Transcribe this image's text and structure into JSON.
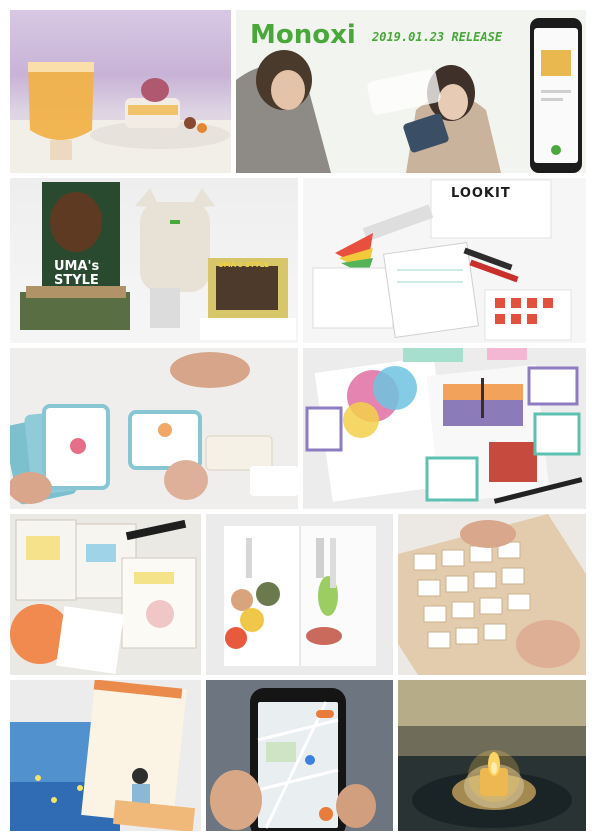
{
  "tiles": {
    "monoxi": {
      "brand": "Monoxi",
      "release": "2019.01.23 RELEASE"
    },
    "lookit": {
      "box_label": "LOOKIT"
    },
    "uma": {
      "poster_line1": "UMA's",
      "poster_line2": "STYLE",
      "small_sign": "UMA's STYLE"
    }
  }
}
